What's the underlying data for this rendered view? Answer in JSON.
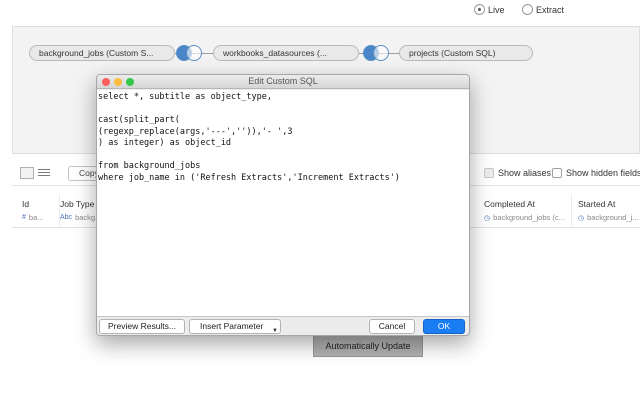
{
  "connection": {
    "live_label": "Live",
    "extract_label": "Extract",
    "selected": "live"
  },
  "canvas": {
    "tables": [
      {
        "label": "background_jobs (Custom S..."
      },
      {
        "label": "workbooks_datasources (..."
      },
      {
        "label": "projects (Custom SQL)"
      }
    ]
  },
  "toolbar": {
    "copy_label": "Copy",
    "show_aliases_label": "Show aliases",
    "show_hidden_label": "Show hidden fields"
  },
  "grid": {
    "columns": [
      {
        "title": "Id",
        "type_icon": "#",
        "source": "ba..."
      },
      {
        "title": "Job Type",
        "type_icon": "Abc",
        "source": "backg..."
      },
      {
        "title": "Completed At",
        "type_icon": "◷",
        "source": "background_jobs (c..."
      },
      {
        "title": "Started At",
        "type_icon": "◷",
        "source": "background_j..."
      }
    ]
  },
  "auto_update_label": "Automatically Update",
  "dialog": {
    "title": "Edit Custom SQL",
    "sql_lines": [
      "select *, subtitle as object_type,",
      "",
      "cast(split_part(",
      "(regexp_replace(args,'---','')),'- ',3",
      ") as integer) as object_id",
      "",
      "from background_jobs",
      "where job_name in ('Refresh Extracts','Increment Extracts')"
    ],
    "preview_label": "Preview Results...",
    "insert_param_label": "Insert Parameter",
    "cancel_label": "Cancel",
    "ok_label": "OK"
  },
  "colors": {
    "accent": "#1b7df4",
    "join_blue": "#4a86c8",
    "traffic_red": "#fc605c",
    "traffic_yellow": "#fdbc40",
    "traffic_green": "#34c84a"
  }
}
